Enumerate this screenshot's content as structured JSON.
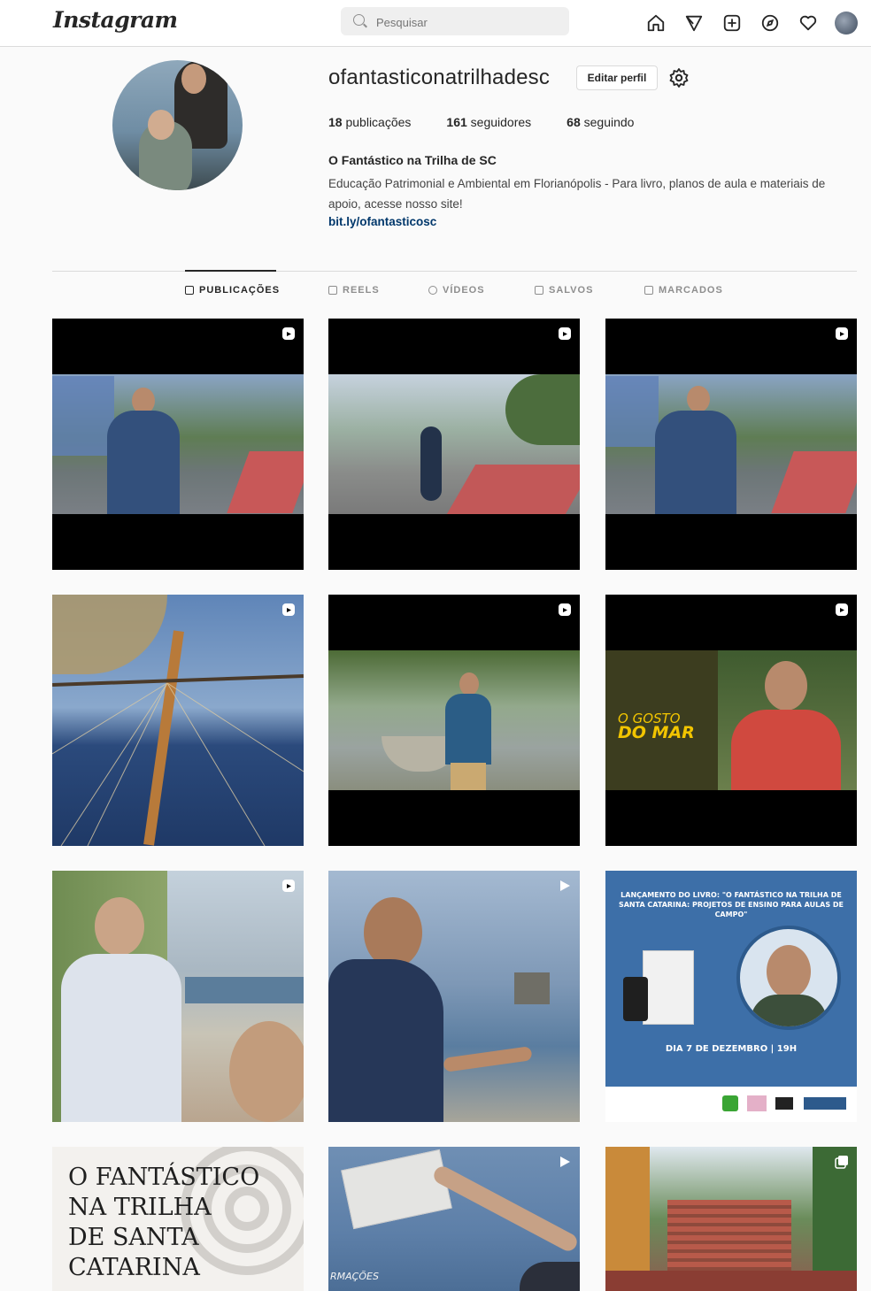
{
  "nav": {
    "logo": "Instagram",
    "search_placeholder": "Pesquisar",
    "icons": [
      "home-icon",
      "direct-icon",
      "new-post-icon",
      "explore-icon",
      "activity-icon",
      "profile-avatar"
    ]
  },
  "profile": {
    "username": "ofantasticonatrilhadesc",
    "edit_label": "Editar perfil",
    "stats": {
      "posts_count": "18",
      "posts_label": "publicações",
      "followers_count": "161",
      "followers_label": "seguidores",
      "following_count": "68",
      "following_label": "seguindo"
    },
    "full_name": "O Fantástico na Trilha de SC",
    "bio": "Educação Patrimonial e Ambiental em Florianópolis - Para livro, planos de aula e materiais de apoio, acesse nosso site!",
    "link": "bit.ly/ofantasticosc"
  },
  "tabs": [
    {
      "label": "PUBLICAÇÕES",
      "active": true
    },
    {
      "label": "REELS",
      "active": false
    },
    {
      "label": "VÍDEOS",
      "active": false
    },
    {
      "label": "SALVOS",
      "active": false
    },
    {
      "label": "MARCADOS",
      "active": false
    }
  ],
  "posts": {
    "tile_9": {
      "headline": "LANÇAMENTO DO LIVRO: \"O FANTÁSTICO NA TRILHA DE SANTA CATARINA: PROJETOS DE ENSINO PARA AULAS DE CAMPO\"",
      "date": "DIA 7 DE DEZEMBRO | 19H"
    },
    "tile_6": {
      "text_line1": "O GOSTO",
      "text_line2": "DO MAR"
    },
    "tile_10": {
      "line1": "O FANTÁSTICO",
      "line2": "NA TRILHA",
      "line3": "DE SANTA",
      "line4": "CATARINA"
    },
    "tile_11": {
      "caption": "RMAÇÕES"
    }
  },
  "colors": {
    "link": "#00376b",
    "border": "#dbdbdb",
    "accent_yellow": "#f2c500",
    "poster_blue": "#3d6fa8"
  }
}
